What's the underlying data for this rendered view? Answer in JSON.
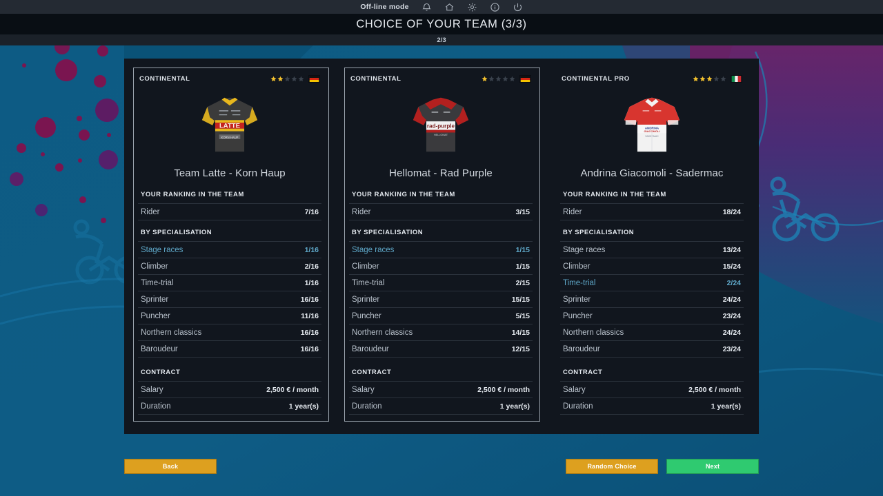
{
  "statusbar": {
    "offline_label": "Off-line mode",
    "icons": [
      {
        "name": "bell-icon",
        "glyph": "bell"
      },
      {
        "name": "home-icon",
        "glyph": "home"
      },
      {
        "name": "gear-icon",
        "glyph": "gear"
      },
      {
        "name": "info-icon",
        "glyph": "info"
      },
      {
        "name": "power-icon",
        "glyph": "power"
      }
    ]
  },
  "header": {
    "title": "CHOICE OF YOUR TEAM (3/3)",
    "substep": "2/3"
  },
  "colors": {
    "background": "#0d5b84",
    "panel": "#11161e",
    "accent_gold": "#dda01f",
    "accent_green": "#2fca70",
    "highlight_row": "#5fa8c9",
    "star_filled": "#f2c12e",
    "star_empty": "#3a424d"
  },
  "section_titles": {
    "ranking": "YOUR RANKING IN THE TEAM",
    "specialisation": "BY SPECIALISATION",
    "contract": "CONTRACT"
  },
  "labels": {
    "rider": "Rider",
    "salary": "Salary",
    "duration": "Duration"
  },
  "cards": [
    {
      "category": "CONTINENTAL",
      "stars_filled": 2,
      "stars_total": 5,
      "flag": "germany",
      "jersey": "latte",
      "team_name": "Team Latte - Korn Haup",
      "rider_rank": "7/16",
      "specialisations": [
        {
          "label": "Stage races",
          "value": "1/16",
          "highlight": true
        },
        {
          "label": "Climber",
          "value": "2/16",
          "highlight": false
        },
        {
          "label": "Time-trial",
          "value": "1/16",
          "highlight": false
        },
        {
          "label": "Sprinter",
          "value": "16/16",
          "highlight": false
        },
        {
          "label": "Puncher",
          "value": "11/16",
          "highlight": false
        },
        {
          "label": "Northern classics",
          "value": "16/16",
          "highlight": false
        },
        {
          "label": "Baroudeur",
          "value": "16/16",
          "highlight": false
        }
      ],
      "salary": "2,500 € / month",
      "duration": "1 year(s)",
      "bordered": true
    },
    {
      "category": "CONTINENTAL",
      "stars_filled": 1,
      "stars_total": 5,
      "flag": "germany",
      "jersey": "radpurple",
      "team_name": "Hellomat - Rad Purple",
      "rider_rank": "3/15",
      "specialisations": [
        {
          "label": "Stage races",
          "value": "1/15",
          "highlight": true
        },
        {
          "label": "Climber",
          "value": "1/15",
          "highlight": false
        },
        {
          "label": "Time-trial",
          "value": "2/15",
          "highlight": false
        },
        {
          "label": "Sprinter",
          "value": "15/15",
          "highlight": false
        },
        {
          "label": "Puncher",
          "value": "5/15",
          "highlight": false
        },
        {
          "label": "Northern classics",
          "value": "14/15",
          "highlight": false
        },
        {
          "label": "Baroudeur",
          "value": "12/15",
          "highlight": false
        }
      ],
      "salary": "2,500 € / month",
      "duration": "1 year(s)",
      "bordered": true
    },
    {
      "category": "CONTINENTAL PRO",
      "stars_filled": 3,
      "stars_total": 5,
      "flag": "italy",
      "jersey": "sadermac",
      "team_name": "Andrina Giacomoli - Sadermac",
      "rider_rank": "18/24",
      "specialisations": [
        {
          "label": "Stage races",
          "value": "13/24",
          "highlight": false
        },
        {
          "label": "Climber",
          "value": "15/24",
          "highlight": false
        },
        {
          "label": "Time-trial",
          "value": "2/24",
          "highlight": true
        },
        {
          "label": "Sprinter",
          "value": "24/24",
          "highlight": false
        },
        {
          "label": "Puncher",
          "value": "23/24",
          "highlight": false
        },
        {
          "label": "Northern classics",
          "value": "24/24",
          "highlight": false
        },
        {
          "label": "Baroudeur",
          "value": "23/24",
          "highlight": false
        }
      ],
      "salary": "2,500 € / month",
      "duration": "1 year(s)",
      "bordered": false
    }
  ],
  "buttons": {
    "back": "Back",
    "random": "Random Choice",
    "next": "Next"
  }
}
